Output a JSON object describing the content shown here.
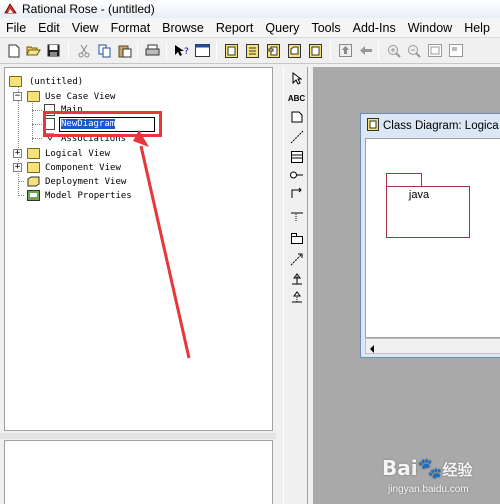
{
  "window": {
    "title": "Rational Rose - (untitled)"
  },
  "menu": [
    "File",
    "Edit",
    "View",
    "Format",
    "Browse",
    "Report",
    "Query",
    "Tools",
    "Add-Ins",
    "Window",
    "Help"
  ],
  "toolbar_icons": [
    "new-icon",
    "open-icon",
    "save-icon",
    "cut-icon",
    "copy-icon",
    "paste-icon",
    "print-icon",
    "context-help-icon",
    "view-doc-icon",
    "browse-class-diagram-icon",
    "browse-interaction-diagram-icon",
    "browse-component-diagram-icon",
    "browse-deployment-diagram-icon",
    "browse-parent-icon",
    "browse-previous-icon",
    "zoom-in-icon",
    "zoom-out-icon",
    "fit-in-window-icon",
    "undo-fit-icon"
  ],
  "browser": {
    "root": "(untitled)",
    "use_case_view": "Use Case View",
    "main": "Main",
    "new_diagram": "NewDiagram",
    "associations": "Associations",
    "logical_view": "Logical View",
    "component_view": "Component View",
    "deployment_view": "Deployment View",
    "model_properties": "Model Properties"
  },
  "diagram_window": {
    "title": "Class Diagram: Logica",
    "package_name": "java"
  },
  "palette_icons": [
    "selection-arrow-icon",
    "text-box-icon",
    "note-icon",
    "anchor-note-icon",
    "class-icon",
    "interface-icon",
    "unidirectional-association-icon",
    "association-class-icon",
    "package-icon",
    "dependency-icon",
    "generalization-icon",
    "realization-icon"
  ],
  "annotation": {
    "color": "#e8373a"
  },
  "watermark": {
    "logo": "Bai",
    "logo_cn": "经验",
    "url": "jingyan.baidu.com"
  }
}
